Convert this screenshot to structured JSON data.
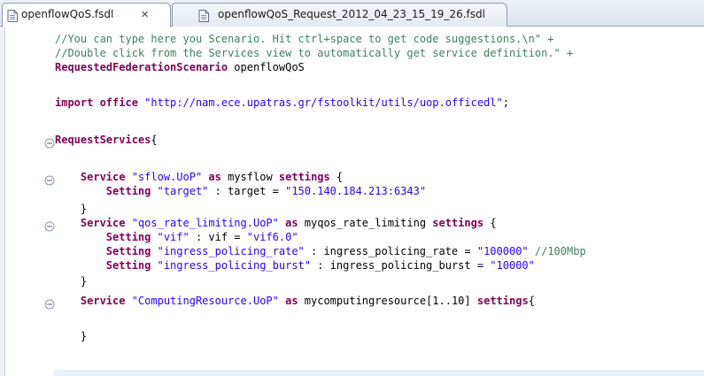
{
  "tabs": [
    {
      "label": "openflowQoS.fsdl",
      "close": "✕",
      "active": true
    },
    {
      "label": "openflowQoS_Request_2012_04_23_15_19_26.fsdl",
      "active": false
    }
  ],
  "colors": {
    "comment": "#3f7f5f",
    "keyword": "#7f0055",
    "string": "#2a00ff",
    "current_line": "#e8f2fe",
    "fold_marker": "#8a96aa"
  },
  "code": {
    "line1": {
      "comment": "//You can type here you Scenario. Hit ctrl+space to get code suggestions.\\n\" +"
    },
    "line2": {
      "comment": "//Double click from the Services view to automatically get service definition.\" +"
    },
    "line3": {
      "kw": "RequestedFederationScenario",
      "rest": " openflowQoS"
    },
    "line5": {
      "kw": "import office",
      "space": " ",
      "str": "\"http://nam.ece.upatras.gr/fstoolkit/utils/uop.officedl\"",
      "rest": ";"
    },
    "line7": {
      "kw": "RequestServices",
      "rest": "{"
    },
    "line9": {
      "indent": "    ",
      "kw1": "Service",
      "str": " \"sflow.UoP\"",
      "kw2": " as",
      "rest": " mysflow",
      "kw3": " settings",
      "end": " {"
    },
    "line10": {
      "indent": "        ",
      "kw": "Setting",
      "str1": " \"target\"",
      "rest": " : target = ",
      "str2": "\"150.140.184.213:6343\""
    },
    "line11": {
      "indent": "    ",
      "rest": "}"
    },
    "line12": {
      "indent": "    ",
      "kw1": "Service",
      "str": " \"qos_rate_limiting.UoP\"",
      "kw2": " as",
      "rest": " myqos_rate_limiting",
      "kw3": " settings",
      "end": " {"
    },
    "line13": {
      "indent": "        ",
      "kw": "Setting",
      "str1": " \"vif\"",
      "rest": " : vif = ",
      "str2": "\"vif6.0\""
    },
    "line14": {
      "indent": "        ",
      "kw": "Setting",
      "str1": " \"ingress_policing_rate\"",
      "rest": " : ingress_policing_rate = ",
      "str2": "\"100000\"",
      "comment": " //100Mbp"
    },
    "line15": {
      "indent": "        ",
      "kw": "Setting",
      "str1": " \"ingress_policing_burst\"",
      "rest": " : ingress_policing_burst = ",
      "str2": "\"10000\""
    },
    "line16": {
      "indent": "    ",
      "rest": "}"
    },
    "line18": {
      "indent": "    ",
      "kw1": "Service",
      "str": " \"ComputingResource.UoP\"",
      "kw2": " as",
      "rest": " mycomputingresource[1..10]",
      "kw3": " settings",
      "end": "{"
    },
    "line20": {
      "indent": "    ",
      "rest": "}"
    }
  }
}
